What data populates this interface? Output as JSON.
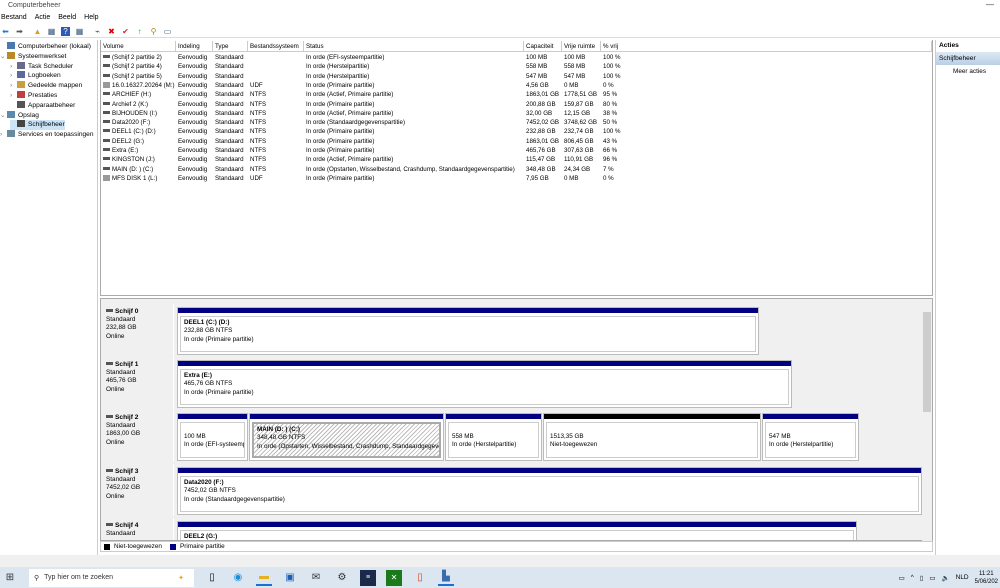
{
  "window": {
    "title": "Computerbeheer",
    "minimize": "—"
  },
  "menu": [
    "Bestand",
    "Actie",
    "Beeld",
    "Help"
  ],
  "toolbar": [
    {
      "icon": "back-arrow-icon",
      "g": "⬅",
      "c": "#1e7bd8"
    },
    {
      "icon": "forward-arrow-icon",
      "g": "➡",
      "c": "#555"
    },
    {
      "icon": "up-folder-icon",
      "g": "▲",
      "c": "#d8a020"
    },
    {
      "icon": "show-hide-tree-icon",
      "g": "▦",
      "c": "#357"
    },
    {
      "icon": "help-icon",
      "g": "?",
      "c": "#fff"
    },
    {
      "icon": "console-view-icon",
      "g": "▦",
      "c": "#357"
    },
    {
      "icon": "connect-icon",
      "g": "⌁",
      "c": "#444"
    },
    {
      "icon": "delete-icon",
      "g": "✖",
      "c": "#d00"
    },
    {
      "icon": "check-icon",
      "g": "✔",
      "c": "#c33"
    },
    {
      "icon": "export-icon",
      "g": "↑",
      "c": "#2a2"
    },
    {
      "icon": "search-icon",
      "g": "⚲",
      "c": "#a80"
    },
    {
      "icon": "properties-icon",
      "g": "▭",
      "c": "#357"
    }
  ],
  "tree": [
    {
      "label": "Computerbeheer (lokaal)",
      "level": 0,
      "icon": "computer-icon"
    },
    {
      "label": "Systeemwerkset",
      "level": 1,
      "icon": "tools-icon",
      "exp": "⌄"
    },
    {
      "label": "Task Scheduler",
      "level": 2,
      "icon": "clock-icon",
      "exp": "›"
    },
    {
      "label": "Logboeken",
      "level": 2,
      "icon": "event-log-icon",
      "exp": "›"
    },
    {
      "label": "Gedeelde mappen",
      "level": 2,
      "icon": "shared-folder-icon",
      "exp": "›"
    },
    {
      "label": "Prestaties",
      "level": 2,
      "icon": "performance-icon",
      "exp": "›"
    },
    {
      "label": "Apparaatbeheer",
      "level": 2,
      "icon": "device-manager-icon"
    },
    {
      "label": "Opslag",
      "level": 1,
      "icon": "storage-icon",
      "exp": "⌄"
    },
    {
      "label": "Schijfbeheer",
      "level": 2,
      "icon": "disk-management-icon",
      "selected": true
    },
    {
      "label": "Services en toepassingen",
      "level": 1,
      "icon": "services-icon",
      "exp": "›"
    }
  ],
  "columns": [
    "Volume",
    "Indeling",
    "Type",
    "Bestandssysteem",
    "Status",
    "Capaciteit",
    "Vrije ruimte",
    "% vrij"
  ],
  "volumes": [
    [
      "(Schijf 2 partitie 2)",
      "Eenvoudig",
      "Standaard",
      "",
      "In orde (EFI-systeempartitie)",
      "100 MB",
      "100 MB",
      "100 %"
    ],
    [
      "(Schijf 2 partitie 4)",
      "Eenvoudig",
      "Standaard",
      "",
      "In orde (Herstelpartitie)",
      "558 MB",
      "558 MB",
      "100 %"
    ],
    [
      "(Schijf 2 partitie 5)",
      "Eenvoudig",
      "Standaard",
      "",
      "In orde (Herstelpartitie)",
      "547 MB",
      "547 MB",
      "100 %"
    ],
    [
      "16.0.16327.20264 (M:)",
      "Eenvoudig",
      "Standaard",
      "UDF",
      "In orde (Primaire partitie)",
      "4,56 GB",
      "0 MB",
      "0 %"
    ],
    [
      "ARCHIEF  (H:)",
      "Eenvoudig",
      "Standaard",
      "NTFS",
      "In orde (Actief, Primaire partitie)",
      "1863,01 GB",
      "1778,51 GB",
      "95 %"
    ],
    [
      "Archief 2 (K:)",
      "Eenvoudig",
      "Standaard",
      "NTFS",
      "In orde (Primaire partitie)",
      "200,88 GB",
      "159,87 GB",
      "80 %"
    ],
    [
      "BIJHOUDEN (I:)",
      "Eenvoudig",
      "Standaard",
      "NTFS",
      "In orde (Actief, Primaire partitie)",
      "32,00 GB",
      "12,15 GB",
      "38 %"
    ],
    [
      "Data2020 (F:)",
      "Eenvoudig",
      "Standaard",
      "NTFS",
      "In orde (Standaardgegevenspartitie)",
      "7452,02 GB",
      "3748,62 GB",
      "50 %"
    ],
    [
      "DEEL1 (C:)  (D:)",
      "Eenvoudig",
      "Standaard",
      "NTFS",
      "In orde (Primaire partitie)",
      "232,88 GB",
      "232,74 GB",
      "100 %"
    ],
    [
      "DEEL2 (G:)",
      "Eenvoudig",
      "Standaard",
      "NTFS",
      "In orde (Primaire partitie)",
      "1863,01 GB",
      "806,45 GB",
      "43 %"
    ],
    [
      "Extra (E:)",
      "Eenvoudig",
      "Standaard",
      "NTFS",
      "In orde (Primaire partitie)",
      "465,76 GB",
      "307,63 GB",
      "66 %"
    ],
    [
      "KINGSTON (J:)",
      "Eenvoudig",
      "Standaard",
      "NTFS",
      "In orde (Actief, Primaire partitie)",
      "115,47 GB",
      "110,91 GB",
      "96 %"
    ],
    [
      "MAIN (D: ) (C:)",
      "Eenvoudig",
      "Standaard",
      "NTFS",
      "In orde (Opstarten, Wisselbestand, Crashdump, Standaardgegevenspartitie)",
      "348,48 GB",
      "24,34 GB",
      "7 %"
    ],
    [
      "MFS DISK 1 (L:)",
      "Eenvoudig",
      "Standaard",
      "UDF",
      "In orde (Primaire partitie)",
      "7,95 GB",
      "0 MB",
      "0 %"
    ]
  ],
  "disks": [
    {
      "name": "Schijf 0",
      "type": "Standaard",
      "size": "232,88 GB",
      "state": "Online",
      "parts": [
        {
          "title": "DEEL1 (C:)  (D:)",
          "l1": "232,88 GB NTFS",
          "l2": "In orde (Primaire partitie)",
          "w": 582
        }
      ]
    },
    {
      "name": "Schijf 1",
      "type": "Standaard",
      "size": "465,76 GB",
      "state": "Online",
      "parts": [
        {
          "title": "Extra  (E:)",
          "l1": "465,76 GB NTFS",
          "l2": "In orde (Primaire partitie)",
          "w": 615
        }
      ]
    },
    {
      "name": "Schijf 2",
      "type": "Standaard",
      "size": "1863,00 GB",
      "state": "Online",
      "parts": [
        {
          "title": "",
          "l1": "100 MB",
          "l2": "In orde (EFI-systeemp",
          "w": 71
        },
        {
          "title": "MAIN (D: )  (C:)",
          "l1": "348,48 GB NTFS",
          "l2": "In orde (Opstarten, Wisselbestand, Crashdump, Standaardgegever",
          "w": 195,
          "active": true
        },
        {
          "title": "",
          "l1": "558 MB",
          "l2": "In orde (Herstelpartitie)",
          "w": 97
        },
        {
          "title": "",
          "l1": "1513,35 GB",
          "l2": "Niet-toegewezen",
          "w": 218,
          "unalloc": true
        },
        {
          "title": "",
          "l1": "547 MB",
          "l2": "In orde (Herstelpartitie)",
          "w": 97
        }
      ]
    },
    {
      "name": "Schijf 3",
      "type": "Standaard",
      "size": "7452,02 GB",
      "state": "Online",
      "parts": [
        {
          "title": "Data2020  (F:)",
          "l1": "7452,02 GB NTFS",
          "l2": "In orde (Standaardgegevenspartitie)",
          "w": 745
        }
      ]
    },
    {
      "name": "Schijf 4",
      "type": "Standaard",
      "size": "",
      "state": "",
      "parts": [
        {
          "title": "DEEL2  (G:)",
          "l1": "",
          "l2": "",
          "w": 680
        }
      ]
    }
  ],
  "legend": {
    "unallocated": "Niet-toegewezen",
    "primary": "Primaire partitie",
    "unallocated_color": "#000000",
    "primary_color": "#000080"
  },
  "actions": {
    "header": "Acties",
    "section": "Schijfbeheer",
    "more": "Meer acties"
  },
  "taskbar": {
    "search_placeholder": "Typ hier om te zoeken",
    "lang": "NLD",
    "time": "11:21",
    "date": "5/06/202"
  }
}
